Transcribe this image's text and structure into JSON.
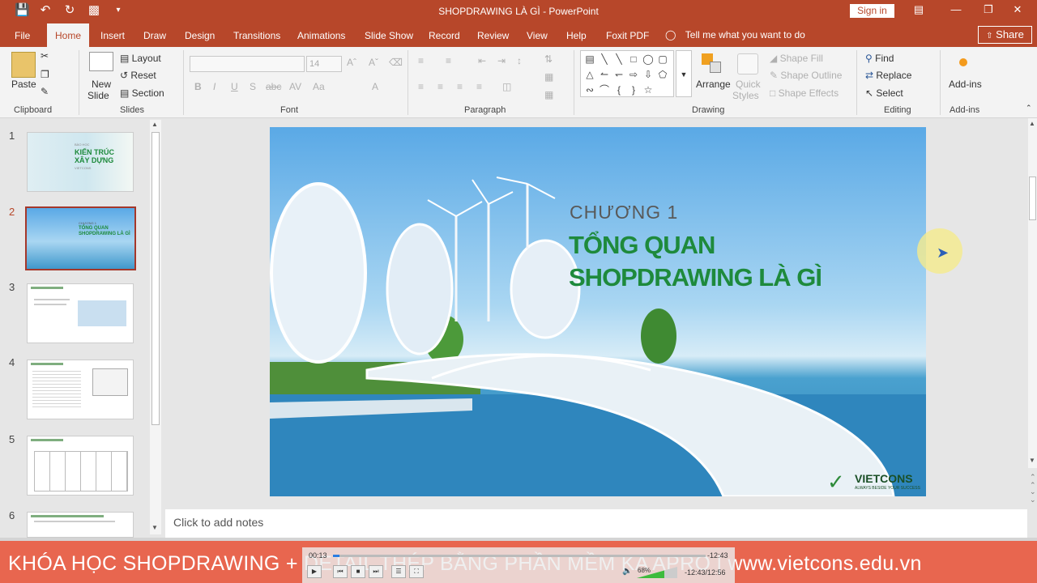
{
  "title_bar": {
    "document_title": "SHOPDRAWING LÀ GÌ - PowerPoint",
    "sign_in": "Sign in",
    "qat_icons": [
      "save-icon",
      "undo-icon",
      "redo-icon",
      "present-icon",
      "customize-icon"
    ],
    "window_controls": [
      "ribbon-display-icon",
      "minimize-icon",
      "restore-icon",
      "close-icon"
    ]
  },
  "tabs": [
    {
      "label": "File"
    },
    {
      "label": "Home"
    },
    {
      "label": "Insert"
    },
    {
      "label": "Draw"
    },
    {
      "label": "Design"
    },
    {
      "label": "Transitions"
    },
    {
      "label": "Animations"
    },
    {
      "label": "Slide Show"
    },
    {
      "label": "Record"
    },
    {
      "label": "Review"
    },
    {
      "label": "View"
    },
    {
      "label": "Help"
    },
    {
      "label": "Foxit PDF"
    }
  ],
  "active_tab": "Home",
  "tell_me": "Tell me what you want to do",
  "share": "Share",
  "ribbon": {
    "clipboard": {
      "paste": "Paste",
      "label": "Clipboard"
    },
    "slides": {
      "new_slide": "New",
      "new_slide2": "Slide",
      "layout": "Layout",
      "reset": "Reset",
      "section": "Section",
      "label": "Slides"
    },
    "font": {
      "size": "14",
      "label": "Font",
      "buttons": [
        "B",
        "I",
        "U",
        "S",
        "abc",
        "AV",
        "Aa",
        "A"
      ]
    },
    "paragraph": {
      "label": "Paragraph"
    },
    "drawing": {
      "arrange": "Arrange",
      "quick_styles": "Quick",
      "quick_styles2": "Styles",
      "shape_fill": "Shape Fill",
      "shape_outline": "Shape Outline",
      "shape_effects": "Shape Effects",
      "label": "Drawing"
    },
    "editing": {
      "find": "Find",
      "replace": "Replace",
      "select": "Select",
      "label": "Editing"
    },
    "addins": {
      "button": "Add-ins",
      "label": "Add-ins"
    }
  },
  "thumbnails": [
    {
      "num": "1"
    },
    {
      "num": "2"
    },
    {
      "num": "3"
    },
    {
      "num": "4"
    },
    {
      "num": "5"
    },
    {
      "num": "6"
    }
  ],
  "selected_slide": 2,
  "thumb1": {
    "line1": "BÀO HỌC",
    "line2": "KIẾN TRÚC",
    "line3": "XÂY DỰNG",
    "line4": "VIETCONS"
  },
  "thumb2": {
    "line1": "CHƯƠNG 1",
    "line2": "TỔNG QUAN",
    "line3": "SHOPDRAWING LÀ GÌ"
  },
  "slide": {
    "chapter": "CHƯƠNG 1",
    "title_line1": "TỔNG QUAN",
    "title_line2": "SHOPDRAWING LÀ GÌ",
    "logo_name": "VIETCONS",
    "logo_tagline": "ALWAYS BESIDE YOUR SUCCESS"
  },
  "notes_placeholder": "Click to add notes",
  "banner": "KHÓA HỌC SHOPDRAWING + DETAIL THÉP BẰNG PHẦN MỀM KA APRO | www.vietcons.edu.vn",
  "player": {
    "elapsed": "00:13",
    "remaining": "-12:43",
    "position": "-12:43/12:56",
    "progress": 0.017,
    "volume": "68%",
    "volume_level": 0.68
  },
  "colors": {
    "accent": "#b7472a",
    "ribbon_bg": "#f3f3f3",
    "banner": "#e8664f",
    "slide_title": "#1e8a3c"
  }
}
